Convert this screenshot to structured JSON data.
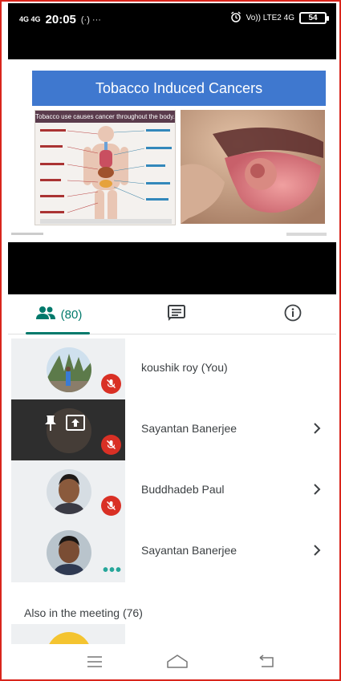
{
  "status_bar": {
    "network_left": "4G 4G",
    "time": "20:05",
    "extra": "(·) ···",
    "network_right": "Vo)) LTE2 4G",
    "battery": "54"
  },
  "slide": {
    "title": "Tobacco Induced Cancers",
    "infographic_heading": "Tobacco use causes cancer throughout the body."
  },
  "tabs": {
    "people_count": "(80)"
  },
  "participants": [
    {
      "name": "koushik roy (You)",
      "muted": true,
      "has_chevron": false
    },
    {
      "name": "Sayantan Banerjee",
      "muted": true,
      "has_chevron": true,
      "presenting": true
    },
    {
      "name": "Buddhadeb Paul",
      "muted": true,
      "has_chevron": true
    },
    {
      "name": "Sayantan Banerjee",
      "muted": false,
      "has_chevron": true,
      "more": "•••"
    }
  ],
  "also_in_meeting": "Also in the meeting (76)",
  "colors": {
    "accent": "#00796b",
    "mute": "#d93025",
    "slide_title_bg": "#3f78cf",
    "frame_border": "#d9251c"
  }
}
